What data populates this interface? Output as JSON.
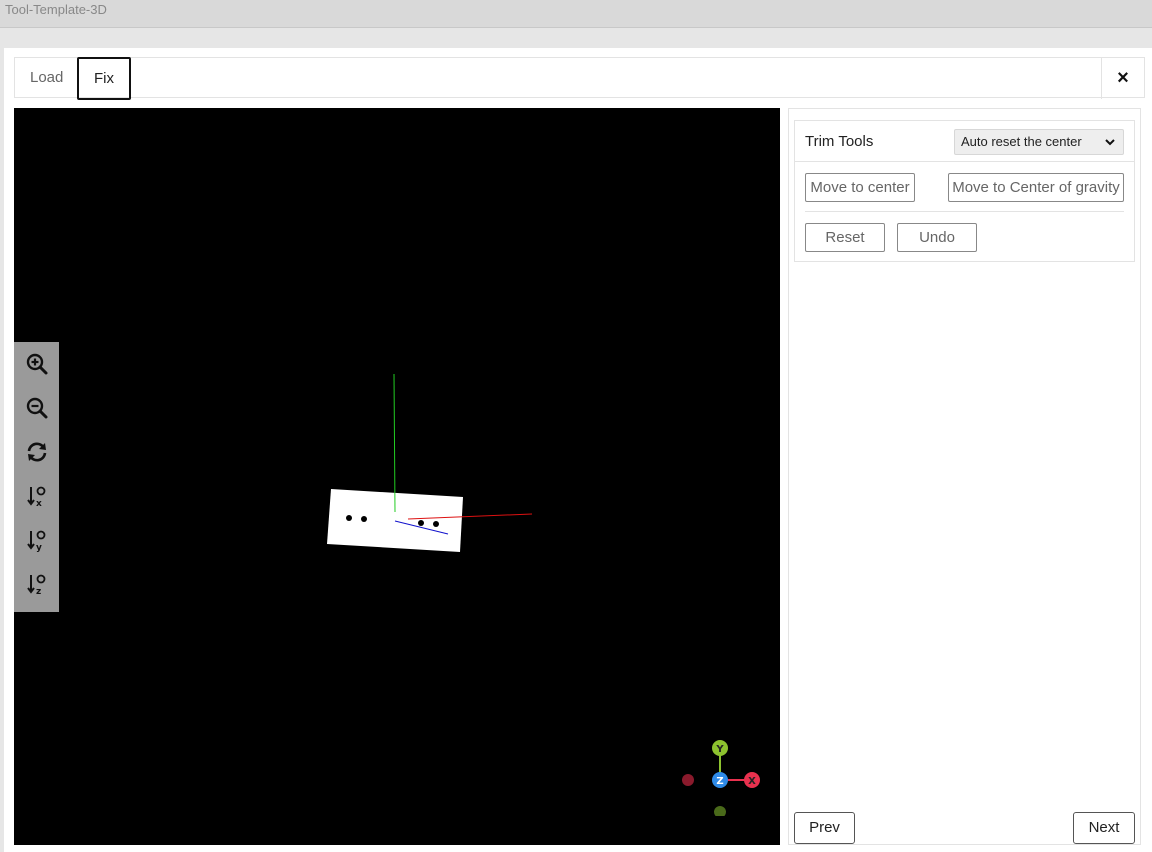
{
  "app": {
    "title": "Tool-Template-3D"
  },
  "tabs": [
    {
      "label": "Load",
      "active": false
    },
    {
      "label": "Fix",
      "active": true
    }
  ],
  "close_label": "×",
  "viewport": {
    "background": "#000000",
    "tools": [
      {
        "name": "zoom-in-icon"
      },
      {
        "name": "zoom-out-icon"
      },
      {
        "name": "refresh-icon"
      },
      {
        "name": "align-x-icon"
      },
      {
        "name": "align-y-icon"
      },
      {
        "name": "align-z-icon"
      }
    ],
    "gizmo": {
      "y": "Y",
      "z": "Z",
      "x": "X"
    }
  },
  "panel": {
    "trim_title": "Trim Tools",
    "select_value": "Auto reset the center",
    "buttons": {
      "move_center": "Move to center",
      "move_gravity": "Move to Center of gravity",
      "reset": "Reset",
      "undo": "Undo"
    },
    "prev": "Prev",
    "next": "Next"
  },
  "colors": {
    "axis_x": "#e8314e",
    "axis_y": "#8dc22f",
    "axis_z": "#2f8be8",
    "toolbar_bg": "#9a9a9a"
  }
}
